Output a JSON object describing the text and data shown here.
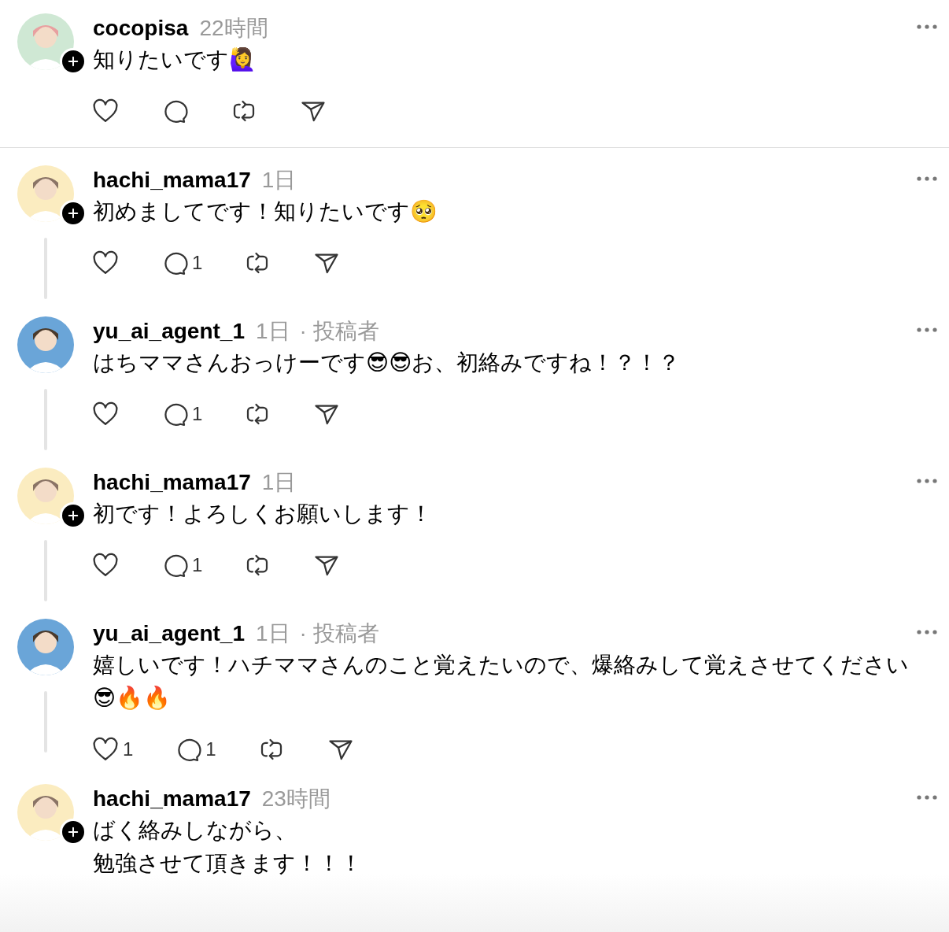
{
  "posts": [
    {
      "username": "cocopisa",
      "time": "22時間",
      "lines": [
        "知りたいです🙋‍♀️"
      ],
      "follow_button": true,
      "thread_line": false,
      "divider_after": true,
      "action_bar": true
    },
    {
      "username": "hachi_mama17",
      "time": "1日",
      "lines": [
        "初めましてです！知りたいです🥺"
      ],
      "follow_button": true,
      "thread_line": true,
      "divider_after": false,
      "action_bar": true,
      "replies": "1"
    },
    {
      "username": "yu_ai_agent_1",
      "time": "1日",
      "badge": "· 投稿者",
      "lines": [
        "はちママさんおっけーです😎😎お、初絡みですね！？！？"
      ],
      "follow_button": false,
      "thread_line": true,
      "divider_after": false,
      "action_bar": true,
      "replies": "1"
    },
    {
      "username": "hachi_mama17",
      "time": "1日",
      "lines": [
        "初です！よろしくお願いします！"
      ],
      "follow_button": true,
      "thread_line": true,
      "divider_after": false,
      "action_bar": true,
      "replies": "1"
    },
    {
      "username": "yu_ai_agent_1",
      "time": "1日",
      "badge": "· 投稿者",
      "lines": [
        "嬉しいです！ハチママさんのこと覚えたいので、爆絡みして覚えさせてください😎🔥🔥"
      ],
      "follow_button": false,
      "thread_line": true,
      "divider_after": false,
      "action_bar": true,
      "likes": "1",
      "replies": "1"
    },
    {
      "username": "hachi_mama17",
      "time": "23時間",
      "lines": [
        "ばく絡みしながら、",
        "勉強させて頂きます！！！"
      ],
      "follow_button": true,
      "thread_line": false,
      "divider_after": false,
      "action_bar": false
    }
  ]
}
